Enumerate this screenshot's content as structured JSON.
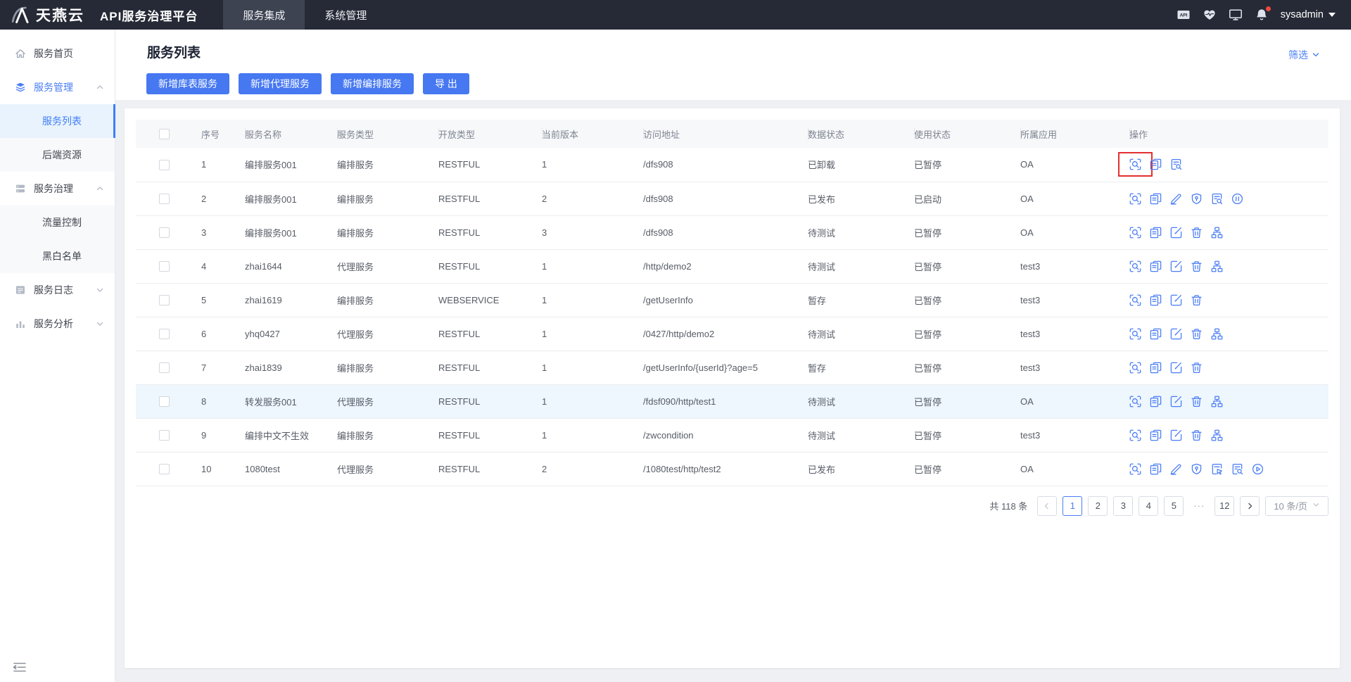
{
  "navbar": {
    "logo_text": "天燕云",
    "product_title": "API服务治理平台",
    "tabs": [
      {
        "label": "服务集成",
        "active": true
      },
      {
        "label": "系统管理",
        "active": false
      }
    ],
    "status_icons": [
      "api-badge-icon",
      "health-icon",
      "monitor-icon",
      "bell-icon"
    ],
    "bell_has_notification": true,
    "username": "sysadmin"
  },
  "sidebar": {
    "items": [
      {
        "label": "服务首页",
        "icon": "home",
        "active": false
      },
      {
        "label": "服务管理",
        "icon": "layers",
        "active": true,
        "expanded": true,
        "children": [
          {
            "label": "服务列表",
            "active": true
          },
          {
            "label": "后端资源",
            "active": false
          }
        ]
      },
      {
        "label": "服务治理",
        "icon": "server",
        "active": false,
        "expanded": true,
        "children": [
          {
            "label": "流量控制",
            "active": false
          },
          {
            "label": "黑白名单",
            "active": false
          }
        ]
      },
      {
        "label": "服务日志",
        "icon": "log",
        "active": false,
        "expanded": false
      },
      {
        "label": "服务分析",
        "icon": "chart",
        "active": false,
        "expanded": false
      }
    ]
  },
  "page": {
    "title": "服务列表",
    "filter_label": "筛选",
    "action_buttons": [
      "新增库表服务",
      "新增代理服务",
      "新增编排服务",
      "导 出"
    ]
  },
  "table": {
    "columns": [
      "序号",
      "服务名称",
      "服务类型",
      "开放类型",
      "当前版本",
      "访问地址",
      "数据状态",
      "使用状态",
      "所属应用",
      "操作"
    ],
    "rows": [
      {
        "index": "1",
        "name": "编排服务001",
        "service_type": "编排服务",
        "open_type": "RESTFUL",
        "version": "1",
        "address": "/dfs908",
        "data_status": "已卸载",
        "use_status": "已暂停",
        "app": "OA",
        "ops": [
          "view",
          "copy",
          "doc-search"
        ],
        "red_box_index": 0
      },
      {
        "index": "2",
        "name": "编排服务001",
        "service_type": "编排服务",
        "open_type": "RESTFUL",
        "version": "2",
        "address": "/dfs908",
        "data_status": "已发布",
        "use_status": "已启动",
        "app": "OA",
        "ops": [
          "view",
          "copy",
          "pencil",
          "shield",
          "doc-search",
          "pause"
        ]
      },
      {
        "index": "3",
        "name": "编排服务001",
        "service_type": "编排服务",
        "open_type": "RESTFUL",
        "version": "3",
        "address": "/dfs908",
        "data_status": "待测试",
        "use_status": "已暂停",
        "app": "OA",
        "ops": [
          "view",
          "copy",
          "edit",
          "trash",
          "sitemap"
        ]
      },
      {
        "index": "4",
        "name": "zhai1644",
        "service_type": "代理服务",
        "open_type": "RESTFUL",
        "version": "1",
        "address": "/http/demo2",
        "data_status": "待测试",
        "use_status": "已暂停",
        "app": "test3",
        "ops": [
          "view",
          "copy",
          "edit",
          "trash",
          "sitemap"
        ]
      },
      {
        "index": "5",
        "name": "zhai1619",
        "service_type": "编排服务",
        "open_type": "WEBSERVICE",
        "version": "1",
        "address": "/getUserInfo",
        "data_status": "暂存",
        "use_status": "已暂停",
        "app": "test3",
        "ops": [
          "view",
          "copy",
          "edit",
          "trash"
        ]
      },
      {
        "index": "6",
        "name": "yhq0427",
        "service_type": "代理服务",
        "open_type": "RESTFUL",
        "version": "1",
        "address": "/0427/http/demo2",
        "data_status": "待测试",
        "use_status": "已暂停",
        "app": "test3",
        "ops": [
          "view",
          "copy",
          "edit",
          "trash",
          "sitemap"
        ]
      },
      {
        "index": "7",
        "name": "zhai1839",
        "service_type": "编排服务",
        "open_type": "RESTFUL",
        "version": "1",
        "address": "/getUserInfo/{userId}?age=5",
        "data_status": "暂存",
        "use_status": "已暂停",
        "app": "test3",
        "ops": [
          "view",
          "copy",
          "edit",
          "trash"
        ]
      },
      {
        "index": "8",
        "name": "转发服务001",
        "service_type": "代理服务",
        "open_type": "RESTFUL",
        "version": "1",
        "address": "/fdsf090/http/test1",
        "data_status": "待测试",
        "use_status": "已暂停",
        "app": "OA",
        "ops": [
          "view",
          "copy",
          "edit",
          "trash",
          "sitemap"
        ],
        "highlighted": true
      },
      {
        "index": "9",
        "name": "编排中文不生效",
        "service_type": "编排服务",
        "open_type": "RESTFUL",
        "version": "1",
        "address": "/zwcondition",
        "data_status": "待测试",
        "use_status": "已暂停",
        "app": "test3",
        "ops": [
          "view",
          "copy",
          "edit",
          "trash",
          "sitemap"
        ]
      },
      {
        "index": "10",
        "name": "1080test",
        "service_type": "代理服务",
        "open_type": "RESTFUL",
        "version": "2",
        "address": "/1080test/http/test2",
        "data_status": "已发布",
        "use_status": "已暂停",
        "app": "OA",
        "ops": [
          "view",
          "copy",
          "pencil",
          "shield",
          "doc-cursor",
          "doc-search",
          "play"
        ]
      }
    ]
  },
  "pagination": {
    "total_label": "共 118 条",
    "pages": [
      "1",
      "2",
      "3",
      "4",
      "5",
      "···",
      "12"
    ],
    "active_page": "1",
    "page_size_label": "10 条/页"
  },
  "colors": {
    "primary": "#4678f2",
    "icon_blue": "#4a7df5",
    "navbar_bg": "#262a36",
    "active_menu_bg": "#e9f3fd",
    "red_annotation": "#e33030"
  }
}
